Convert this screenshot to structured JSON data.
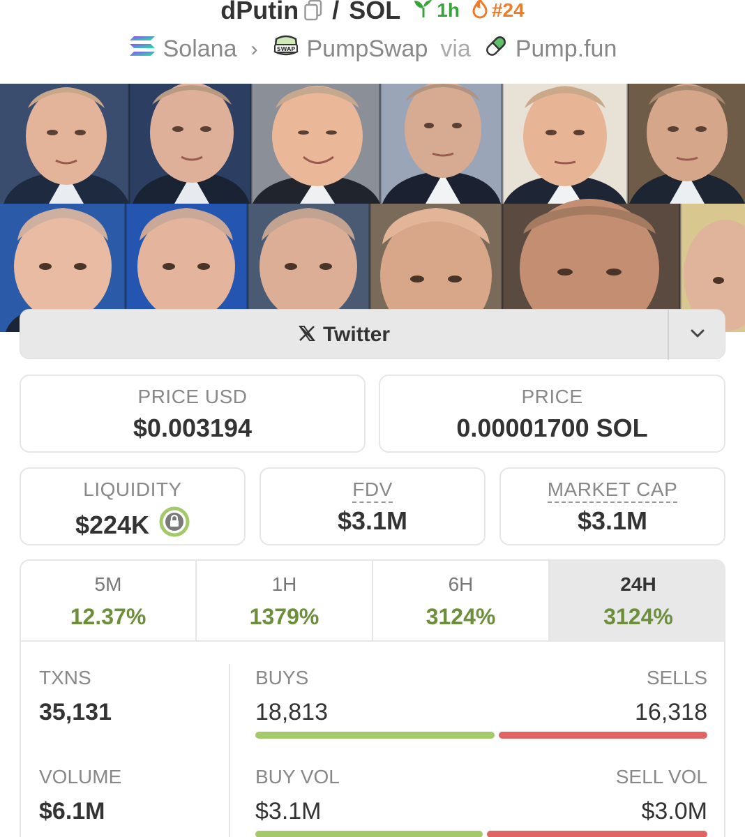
{
  "header": {
    "token_name": "dPutin",
    "quote_symbol": "SOL",
    "age": "1h",
    "rank": "#24"
  },
  "breadcrumb": {
    "chain": "Solana",
    "dex": "PumpSwap",
    "via": "via",
    "launchpad": "Pump.fun"
  },
  "social": {
    "twitter_label": "Twitter"
  },
  "prices": {
    "price_usd_label": "PRICE USD",
    "price_usd": "$0.003194",
    "price_label": "PRICE",
    "price_native": "0.00001700 SOL"
  },
  "metrics": {
    "liquidity_label": "LIQUIDITY",
    "liquidity": "$224K",
    "fdv_label": "FDV",
    "fdv": "$3.1M",
    "mcap_label": "MARKET CAP",
    "mcap": "$3.1M"
  },
  "timeframes": [
    {
      "label": "5M",
      "change": "12.37%",
      "active": false
    },
    {
      "label": "1H",
      "change": "1379%",
      "active": false
    },
    {
      "label": "6H",
      "change": "3124%",
      "active": false
    },
    {
      "label": "24H",
      "change": "3124%",
      "active": true
    }
  ],
  "stats": {
    "txns_label": "TXNS",
    "txns": "35,131",
    "buys_label": "BUYS",
    "buys": "18,813",
    "sells_label": "SELLS",
    "sells": "16,318",
    "buy_share": 0.535,
    "volume_label": "VOLUME",
    "volume": "$6.1M",
    "buy_vol_label": "BUY VOL",
    "buy_vol": "$3.1M",
    "sell_vol_label": "SELL VOL",
    "sell_vol": "$3.0M",
    "buy_vol_share": 0.508
  },
  "colors": {
    "positive": "#6b8f3a",
    "buy_bar": "#a4c96a",
    "sell_bar": "#e06464",
    "age_green": "#3aa23a",
    "rank_orange": "#ef7a27"
  }
}
